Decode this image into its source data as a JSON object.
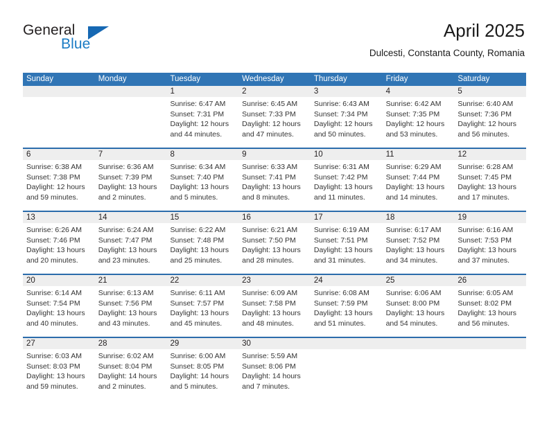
{
  "logo": {
    "word_top": "General",
    "word_bottom": "Blue",
    "triangle_color": "#1668b3",
    "blue_text_color": "#1a7bc4"
  },
  "header": {
    "title": "April 2025",
    "subtitle": "Dulcesti, Constanta County, Romania"
  },
  "theme": {
    "header_blue": "#3075b5",
    "rule_blue": "#2b6cab",
    "daynum_band": "#eeeeee"
  },
  "weekdays": [
    "Sunday",
    "Monday",
    "Tuesday",
    "Wednesday",
    "Thursday",
    "Friday",
    "Saturday"
  ],
  "labels": {
    "sunrise_prefix": "Sunrise:",
    "sunset_prefix": "Sunset:",
    "daylight_prefix": "Daylight:"
  },
  "weeks": [
    [
      {
        "day": "",
        "sunrise": "",
        "sunset": "",
        "daylight_a": "",
        "daylight_b": ""
      },
      {
        "day": "",
        "sunrise": "",
        "sunset": "",
        "daylight_a": "",
        "daylight_b": ""
      },
      {
        "day": "1",
        "sunrise": "Sunrise: 6:47 AM",
        "sunset": "Sunset: 7:31 PM",
        "daylight_a": "Daylight: 12 hours",
        "daylight_b": "and 44 minutes."
      },
      {
        "day": "2",
        "sunrise": "Sunrise: 6:45 AM",
        "sunset": "Sunset: 7:33 PM",
        "daylight_a": "Daylight: 12 hours",
        "daylight_b": "and 47 minutes."
      },
      {
        "day": "3",
        "sunrise": "Sunrise: 6:43 AM",
        "sunset": "Sunset: 7:34 PM",
        "daylight_a": "Daylight: 12 hours",
        "daylight_b": "and 50 minutes."
      },
      {
        "day": "4",
        "sunrise": "Sunrise: 6:42 AM",
        "sunset": "Sunset: 7:35 PM",
        "daylight_a": "Daylight: 12 hours",
        "daylight_b": "and 53 minutes."
      },
      {
        "day": "5",
        "sunrise": "Sunrise: 6:40 AM",
        "sunset": "Sunset: 7:36 PM",
        "daylight_a": "Daylight: 12 hours",
        "daylight_b": "and 56 minutes."
      }
    ],
    [
      {
        "day": "6",
        "sunrise": "Sunrise: 6:38 AM",
        "sunset": "Sunset: 7:38 PM",
        "daylight_a": "Daylight: 12 hours",
        "daylight_b": "and 59 minutes."
      },
      {
        "day": "7",
        "sunrise": "Sunrise: 6:36 AM",
        "sunset": "Sunset: 7:39 PM",
        "daylight_a": "Daylight: 13 hours",
        "daylight_b": "and 2 minutes."
      },
      {
        "day": "8",
        "sunrise": "Sunrise: 6:34 AM",
        "sunset": "Sunset: 7:40 PM",
        "daylight_a": "Daylight: 13 hours",
        "daylight_b": "and 5 minutes."
      },
      {
        "day": "9",
        "sunrise": "Sunrise: 6:33 AM",
        "sunset": "Sunset: 7:41 PM",
        "daylight_a": "Daylight: 13 hours",
        "daylight_b": "and 8 minutes."
      },
      {
        "day": "10",
        "sunrise": "Sunrise: 6:31 AM",
        "sunset": "Sunset: 7:42 PM",
        "daylight_a": "Daylight: 13 hours",
        "daylight_b": "and 11 minutes."
      },
      {
        "day": "11",
        "sunrise": "Sunrise: 6:29 AM",
        "sunset": "Sunset: 7:44 PM",
        "daylight_a": "Daylight: 13 hours",
        "daylight_b": "and 14 minutes."
      },
      {
        "day": "12",
        "sunrise": "Sunrise: 6:28 AM",
        "sunset": "Sunset: 7:45 PM",
        "daylight_a": "Daylight: 13 hours",
        "daylight_b": "and 17 minutes."
      }
    ],
    [
      {
        "day": "13",
        "sunrise": "Sunrise: 6:26 AM",
        "sunset": "Sunset: 7:46 PM",
        "daylight_a": "Daylight: 13 hours",
        "daylight_b": "and 20 minutes."
      },
      {
        "day": "14",
        "sunrise": "Sunrise: 6:24 AM",
        "sunset": "Sunset: 7:47 PM",
        "daylight_a": "Daylight: 13 hours",
        "daylight_b": "and 23 minutes."
      },
      {
        "day": "15",
        "sunrise": "Sunrise: 6:22 AM",
        "sunset": "Sunset: 7:48 PM",
        "daylight_a": "Daylight: 13 hours",
        "daylight_b": "and 25 minutes."
      },
      {
        "day": "16",
        "sunrise": "Sunrise: 6:21 AM",
        "sunset": "Sunset: 7:50 PM",
        "daylight_a": "Daylight: 13 hours",
        "daylight_b": "and 28 minutes."
      },
      {
        "day": "17",
        "sunrise": "Sunrise: 6:19 AM",
        "sunset": "Sunset: 7:51 PM",
        "daylight_a": "Daylight: 13 hours",
        "daylight_b": "and 31 minutes."
      },
      {
        "day": "18",
        "sunrise": "Sunrise: 6:17 AM",
        "sunset": "Sunset: 7:52 PM",
        "daylight_a": "Daylight: 13 hours",
        "daylight_b": "and 34 minutes."
      },
      {
        "day": "19",
        "sunrise": "Sunrise: 6:16 AM",
        "sunset": "Sunset: 7:53 PM",
        "daylight_a": "Daylight: 13 hours",
        "daylight_b": "and 37 minutes."
      }
    ],
    [
      {
        "day": "20",
        "sunrise": "Sunrise: 6:14 AM",
        "sunset": "Sunset: 7:54 PM",
        "daylight_a": "Daylight: 13 hours",
        "daylight_b": "and 40 minutes."
      },
      {
        "day": "21",
        "sunrise": "Sunrise: 6:13 AM",
        "sunset": "Sunset: 7:56 PM",
        "daylight_a": "Daylight: 13 hours",
        "daylight_b": "and 43 minutes."
      },
      {
        "day": "22",
        "sunrise": "Sunrise: 6:11 AM",
        "sunset": "Sunset: 7:57 PM",
        "daylight_a": "Daylight: 13 hours",
        "daylight_b": "and 45 minutes."
      },
      {
        "day": "23",
        "sunrise": "Sunrise: 6:09 AM",
        "sunset": "Sunset: 7:58 PM",
        "daylight_a": "Daylight: 13 hours",
        "daylight_b": "and 48 minutes."
      },
      {
        "day": "24",
        "sunrise": "Sunrise: 6:08 AM",
        "sunset": "Sunset: 7:59 PM",
        "daylight_a": "Daylight: 13 hours",
        "daylight_b": "and 51 minutes."
      },
      {
        "day": "25",
        "sunrise": "Sunrise: 6:06 AM",
        "sunset": "Sunset: 8:00 PM",
        "daylight_a": "Daylight: 13 hours",
        "daylight_b": "and 54 minutes."
      },
      {
        "day": "26",
        "sunrise": "Sunrise: 6:05 AM",
        "sunset": "Sunset: 8:02 PM",
        "daylight_a": "Daylight: 13 hours",
        "daylight_b": "and 56 minutes."
      }
    ],
    [
      {
        "day": "27",
        "sunrise": "Sunrise: 6:03 AM",
        "sunset": "Sunset: 8:03 PM",
        "daylight_a": "Daylight: 13 hours",
        "daylight_b": "and 59 minutes."
      },
      {
        "day": "28",
        "sunrise": "Sunrise: 6:02 AM",
        "sunset": "Sunset: 8:04 PM",
        "daylight_a": "Daylight: 14 hours",
        "daylight_b": "and 2 minutes."
      },
      {
        "day": "29",
        "sunrise": "Sunrise: 6:00 AM",
        "sunset": "Sunset: 8:05 PM",
        "daylight_a": "Daylight: 14 hours",
        "daylight_b": "and 5 minutes."
      },
      {
        "day": "30",
        "sunrise": "Sunrise: 5:59 AM",
        "sunset": "Sunset: 8:06 PM",
        "daylight_a": "Daylight: 14 hours",
        "daylight_b": "and 7 minutes."
      },
      {
        "day": "",
        "sunrise": "",
        "sunset": "",
        "daylight_a": "",
        "daylight_b": ""
      },
      {
        "day": "",
        "sunrise": "",
        "sunset": "",
        "daylight_a": "",
        "daylight_b": ""
      },
      {
        "day": "",
        "sunrise": "",
        "sunset": "",
        "daylight_a": "",
        "daylight_b": ""
      }
    ]
  ]
}
